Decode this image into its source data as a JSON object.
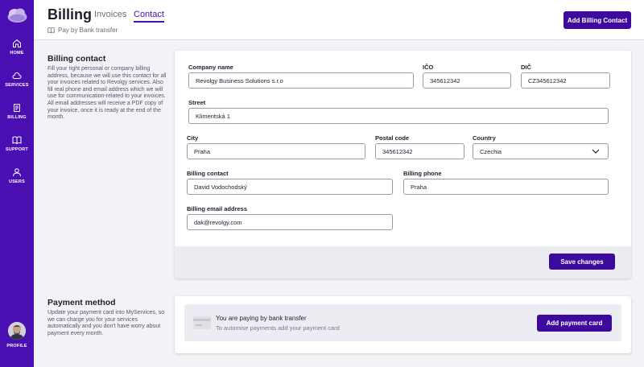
{
  "sidebar": {
    "items": [
      {
        "label": "HOME",
        "icon": "home-icon"
      },
      {
        "label": "SERVICES",
        "icon": "cloud-icon"
      },
      {
        "label": "BILLING",
        "icon": "document-icon"
      },
      {
        "label": "SUPPORT",
        "icon": "book-icon"
      },
      {
        "label": "USERS",
        "icon": "user-icon"
      }
    ],
    "profile_label": "PROFILE"
  },
  "header": {
    "title": "Billing",
    "tabs": [
      {
        "label": "Invoices",
        "active": false
      },
      {
        "label": "Contact",
        "active": true
      }
    ],
    "subtitle": "Pay by Bank transfer",
    "add_contact_button": "Add Billing Contact"
  },
  "billing_contact": {
    "title": "Billing contact",
    "description": "Fill your right personal or company billing address, because we will use this contact for all your invoices related to Revolgy services. Also fill real phone and email address which we will use for communication-related to your invoices. All email addresses will receive a PDF copy of your invoice, once it is ready at the end of the month.",
    "fields": {
      "company_name": {
        "label": "Company name",
        "value": "Revolgy Business Solutions s.r.o"
      },
      "ico": {
        "label": "IČO",
        "value": "345612342"
      },
      "dic": {
        "label": "DIČ",
        "value": "CZ345612342"
      },
      "street": {
        "label": "Street",
        "value": "Klimentská 1"
      },
      "city": {
        "label": "City",
        "value": "Praha"
      },
      "postal_code": {
        "label": "Postal code",
        "value": "345612342"
      },
      "country": {
        "label": "Country",
        "value": "Czechia"
      },
      "billing_contact": {
        "label": "Billing contact",
        "value": "David Vodochodský"
      },
      "billing_phone": {
        "label": "Billing phone",
        "value": "Praha"
      },
      "billing_email": {
        "label": "Billing email address",
        "value": "dak@revolgy.com"
      }
    },
    "save_button": "Save changes"
  },
  "payment_method": {
    "title": "Payment method",
    "description": "Update your payment card into MyServices, so we can charge you for your services automatically and you don't have worry about payment every month.",
    "status_title": "You are paying by bank transfer",
    "status_subtitle": "To automise payments add your payment card",
    "add_card_button": "Add payment card"
  },
  "colors": {
    "brand": "#4a0fb3",
    "button": "#3e0a9e",
    "background": "#f3f3f7"
  }
}
